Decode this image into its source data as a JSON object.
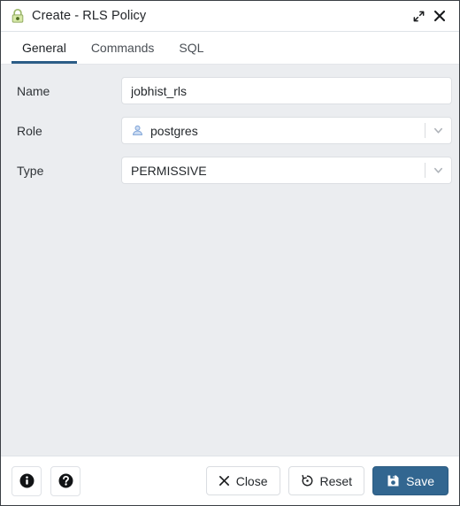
{
  "window": {
    "title": "Create - RLS Policy",
    "icon": "lock-icon",
    "expand_label": "",
    "close_label": ""
  },
  "tabs": [
    {
      "label": "General",
      "active": true
    },
    {
      "label": "Commands",
      "active": false
    },
    {
      "label": "SQL",
      "active": false
    }
  ],
  "fields": {
    "name": {
      "label": "Name",
      "value": "jobhist_rls",
      "placeholder": ""
    },
    "role": {
      "label": "Role",
      "value": "postgres",
      "icon": "user-icon"
    },
    "type": {
      "label": "Type",
      "value": "PERMISSIVE"
    }
  },
  "footer": {
    "info_label": "",
    "help_label": "",
    "close_label": "Close",
    "reset_label": "Reset",
    "save_label": "Save"
  },
  "colors": {
    "accent": "#326690",
    "tab_underline": "#2c5d87",
    "body_bg": "#ebedf0",
    "panel_bg": "#ffffff",
    "lock_green": "#c6dd9a",
    "role_blue": "#b4cdec"
  }
}
